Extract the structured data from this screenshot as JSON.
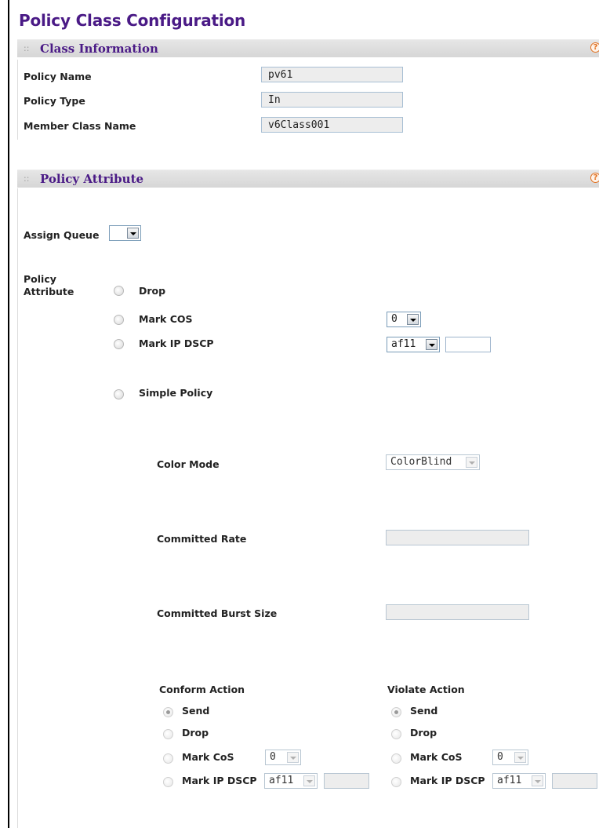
{
  "page_title": "Policy Class Configuration",
  "class_information": {
    "title": "Class Information",
    "help": "?",
    "fields": [
      {
        "label": "Policy Name",
        "value": "pv61"
      },
      {
        "label": "Policy Type",
        "value": "In"
      },
      {
        "label": "Member Class Name",
        "value": "v6Class001"
      }
    ]
  },
  "policy_attribute": {
    "title": "Policy Attribute",
    "help": "?",
    "assign_queue": {
      "label": "Assign Queue",
      "value": ""
    },
    "attribute_label_line1": "Policy",
    "attribute_label_line2": "Attribute",
    "options": {
      "drop": "Drop",
      "mark_cos": {
        "label": "Mark COS",
        "value": "0"
      },
      "mark_ip_dscp": {
        "label": "Mark IP DSCP",
        "value": "af11",
        "text": ""
      },
      "simple_policy": "Simple Policy"
    },
    "color_mode": {
      "label": "Color Mode",
      "value": "ColorBlind"
    },
    "committed_rate": {
      "label": "Committed Rate",
      "value": ""
    },
    "committed_burst_size": {
      "label": "Committed Burst Size",
      "value": ""
    },
    "conform_action": {
      "title": "Conform Action",
      "send": "Send",
      "drop": "Drop",
      "mark_cos": {
        "label": "Mark CoS",
        "value": "0"
      },
      "mark_ip_dscp": {
        "label": "Mark IP DSCP",
        "value": "af11",
        "text": ""
      }
    },
    "violate_action": {
      "title": "Violate Action",
      "send": "Send",
      "drop": "Drop",
      "mark_cos": {
        "label": "Mark CoS",
        "value": "0"
      },
      "mark_ip_dscp": {
        "label": "Mark IP DSCP",
        "value": "af11",
        "text": ""
      }
    }
  },
  "colors": {
    "title": "#4a1a86",
    "help": "#e07020",
    "header_bg": "#dcdcdc"
  }
}
